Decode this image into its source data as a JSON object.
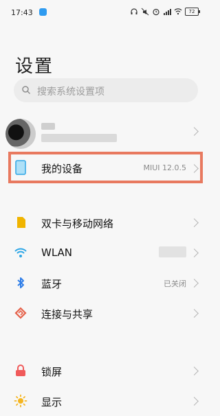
{
  "status": {
    "time": "17:43",
    "battery": "72"
  },
  "page": {
    "title": "设置"
  },
  "search": {
    "placeholder": "搜索系统设置项"
  },
  "device": {
    "label": "我的设备",
    "value": "MIUI 12.0.5"
  },
  "network": [
    {
      "label": "双卡与移动网络",
      "value": "",
      "icon": "sim-card-icon"
    },
    {
      "label": "WLAN",
      "value": "",
      "icon": "wifi-icon"
    },
    {
      "label": "蓝牙",
      "value": "已关闭",
      "icon": "bluetooth-icon"
    },
    {
      "label": "连接与共享",
      "value": "",
      "icon": "share-connection-icon"
    }
  ],
  "display_section": [
    {
      "label": "锁屏",
      "icon": "lock-icon"
    },
    {
      "label": "显示",
      "icon": "sun-icon"
    }
  ],
  "colors": {
    "highlight": "#e8795f",
    "sim": "#f0b400",
    "wifi": "#2da6e6",
    "bluetooth": "#2f7ee8",
    "share": "#e5614a",
    "lock": "#f05a5a",
    "display": "#f5b51f"
  }
}
